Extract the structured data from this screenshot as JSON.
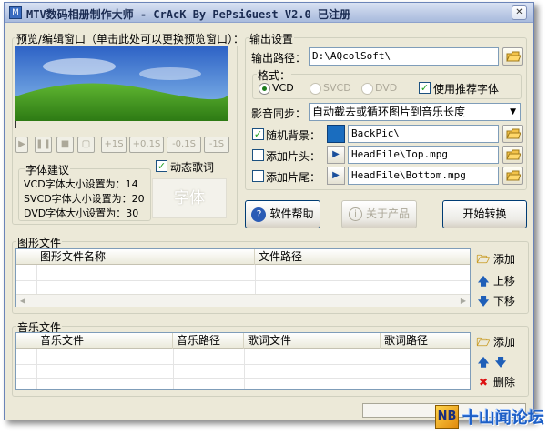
{
  "title": "MTV数码相册制作大师 - CrAcK By PePsiGuest V2.0   已注册",
  "title_icon": "app-icon",
  "preview": {
    "label": "预览/编辑窗口（单击此处可以更换预览窗口）：",
    "image": "green-hill-blue-sky",
    "controls": [
      "+1S",
      "+0.1S",
      "-0.1S",
      "-1S"
    ]
  },
  "font_tip": {
    "title": "字体建议",
    "lines": [
      "VCD字体大小设置为：14",
      "SVCD字体大小设置为：20",
      "DVD字体大小设置为：30"
    ],
    "dynamic_lyrics_label": "动态歌词",
    "dynamic_lyrics_checked": true,
    "font_preview": "字体"
  },
  "output": {
    "title": "输出设置",
    "path_label": "输出路径：",
    "path_value": "D:\\AQcolSoft\\",
    "format_label": "格式：",
    "formats": [
      "VCD",
      "SVCD",
      "DVD"
    ],
    "selected_format": "VCD",
    "recommend_font_label": "使用推荐字体",
    "recommend_font_checked": true,
    "sync_label": "影音同步：",
    "sync_value": "自动截去或循环图片到音乐长度",
    "bg_label": "随机背景：",
    "bg_checked": true,
    "bg_value": "BackPic\\",
    "bg_color": "#1a6dbf",
    "head_label": "添加片头：",
    "head_checked": false,
    "head_value": "HeadFile\\Top.mpg",
    "tail_label": "添加片尾：",
    "tail_checked": false,
    "tail_value": "HeadFile\\Bottom.mpg"
  },
  "buttons": {
    "help": "软件帮助",
    "about": "关于产品",
    "start": "开始转换"
  },
  "image_files": {
    "title": "图形文件",
    "columns": [
      "图形文件名称",
      "文件路径"
    ],
    "add": "添加",
    "up": "上移",
    "down": "下移"
  },
  "music_files": {
    "title": "音乐文件",
    "columns": [
      "音乐文件",
      "音乐路径",
      "歌词文件",
      "歌词路径"
    ],
    "add": "添加",
    "delete": "删除"
  },
  "watermark": "NB 十山闻论坛"
}
